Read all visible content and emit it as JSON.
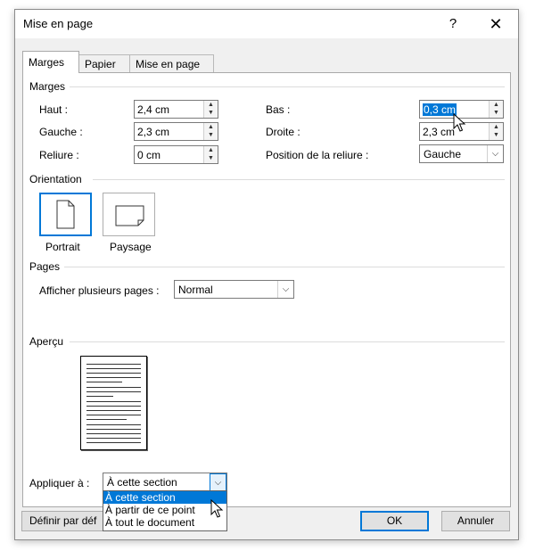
{
  "window": {
    "title": "Mise en page",
    "help_label": "?",
    "close_label": "✕"
  },
  "tabs": [
    {
      "label": "Marges",
      "active": true
    },
    {
      "label": "Papier",
      "active": false
    },
    {
      "label": "Mise en page",
      "active": false
    }
  ],
  "margins": {
    "group_title": "Marges",
    "top": {
      "label": "Haut :",
      "value": "2,4 cm"
    },
    "left": {
      "label": "Gauche :",
      "value": "2,3 cm"
    },
    "gutter": {
      "label": "Reliure :",
      "value": "0 cm"
    },
    "bottom": {
      "label": "Bas :",
      "value": "0,3 cm"
    },
    "right": {
      "label": "Droite :",
      "value": "2,3 cm"
    },
    "gutter_position": {
      "label": "Position de la reliure :",
      "value": "Gauche"
    }
  },
  "orientation": {
    "group_title": "Orientation",
    "portrait_label": "Portrait",
    "landscape_label": "Paysage",
    "selected": "Portrait"
  },
  "pages": {
    "group_title": "Pages",
    "multiple_label": "Afficher plusieurs pages :",
    "multiple_value": "Normal"
  },
  "preview": {
    "group_title": "Aperçu"
  },
  "apply": {
    "label": "Appliquer à :",
    "value": "À cette section",
    "options": [
      "À cette section",
      "À partir de ce point",
      "À tout le document"
    ]
  },
  "footer": {
    "default_label": "Définir par déf",
    "ok_label": "OK",
    "cancel_label": "Annuler"
  },
  "colors": {
    "accent": "#0078d7",
    "dialog_bg": "#f0f0f0",
    "panel_bg": "#ffffff"
  },
  "icons": {
    "dropdown": "chevron-down-icon",
    "spin_up": "spin-up-icon",
    "spin_down": "spin-down-icon"
  }
}
